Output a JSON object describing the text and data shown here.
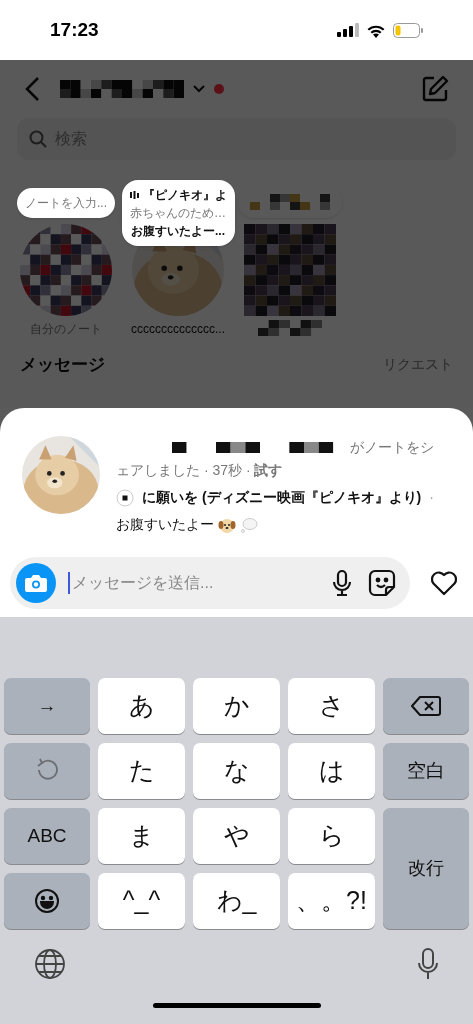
{
  "status_bar": {
    "time": "17:23"
  },
  "search": {
    "placeholder": "検索"
  },
  "notes": [
    {
      "kind": "own",
      "bubble": [
        "ノートを入力..."
      ],
      "label": "自分のノート"
    },
    {
      "kind": "music",
      "bubble": [
        "『ピノキオ』よ",
        "赤ちゃんのため…",
        "お腹すいたよー..."
      ],
      "label": "cccccccccccccc..."
    },
    {
      "kind": "hidden"
    }
  ],
  "messages_section": {
    "title": "メッセージ",
    "requests": "リクエスト"
  },
  "note_sheet": {
    "shared_text_lines": [
      "がノートをシ",
      "ェアしました · 37秒 · **試す**"
    ],
    "song": "に願いを (ディズニー映画『ピノキオ』より)",
    "separator": "·",
    "note": "お腹すいたよー"
  },
  "composer": {
    "placeholder": "メッセージを送信..."
  },
  "keyboard": {
    "keys": [
      {
        "kind": "function",
        "label": "→"
      },
      {
        "kind": "char",
        "label": "あ"
      },
      {
        "kind": "char",
        "label": "か"
      },
      {
        "kind": "char",
        "label": "さ"
      },
      {
        "kind": "delete"
      },
      {
        "kind": "undo"
      },
      {
        "kind": "char",
        "label": "た"
      },
      {
        "kind": "char",
        "label": "な"
      },
      {
        "kind": "char",
        "label": "は"
      },
      {
        "kind": "function",
        "label": "空白"
      },
      {
        "kind": "function",
        "label": "ABC"
      },
      {
        "kind": "char",
        "label": "ま"
      },
      {
        "kind": "char",
        "label": "や"
      },
      {
        "kind": "char",
        "label": "ら"
      },
      {
        "kind": "return",
        "label": "改行"
      },
      {
        "kind": "emoji"
      },
      {
        "kind": "char",
        "label": "^_^"
      },
      {
        "kind": "char",
        "label": "わ_"
      },
      {
        "kind": "char",
        "label": "、。?!"
      }
    ]
  }
}
